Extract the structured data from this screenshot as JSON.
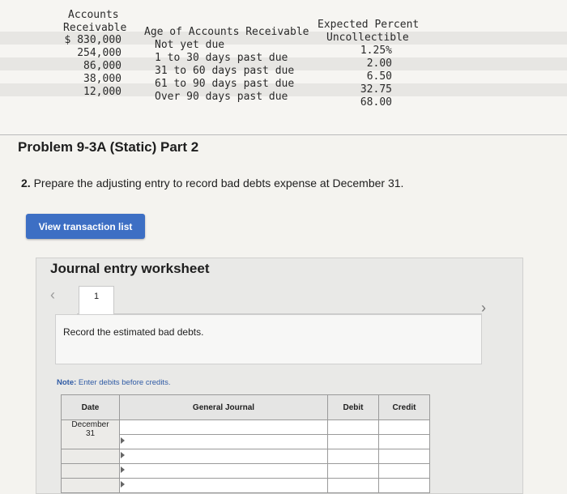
{
  "aging_schedule": {
    "receivable_header": [
      "Accounts",
      "Receivable"
    ],
    "age_header": "Age of Accounts Receivable",
    "percent_header": [
      "Expected Percent",
      "Uncollectible"
    ],
    "rows": [
      {
        "amount": "$ 830,000",
        "age": "Not yet due",
        "percent": "1.25%"
      },
      {
        "amount": "254,000",
        "age": "1 to 30 days past due",
        "percent": "2.00"
      },
      {
        "amount": "86,000",
        "age": "31 to 60 days past due",
        "percent": "6.50"
      },
      {
        "amount": "38,000",
        "age": "61 to 90 days past due",
        "percent": "32.75"
      },
      {
        "amount": "12,000",
        "age": "Over 90 days past due",
        "percent": "68.00"
      }
    ]
  },
  "problem": {
    "title": "Problem 9-3A (Static) Part 2",
    "instruction_number": "2.",
    "instruction_text": " Prepare the adjusting entry to record bad debts expense at December 31."
  },
  "view_transaction_button": "View transaction list",
  "worksheet": {
    "title": "Journal entry worksheet",
    "tab_number": "1",
    "description": "Record the estimated bad debts.",
    "note_label": "Note:",
    "note_text": " Enter debits before credits."
  },
  "journal_table": {
    "headers": {
      "date": "Date",
      "general_journal": "General Journal",
      "debit": "Debit",
      "credit": "Credit"
    },
    "date_month": "December",
    "date_day": "31"
  },
  "colors": {
    "button_blue": "#3d6fc4",
    "note_blue": "#2e5aa4"
  },
  "icons": {
    "prev": "chevron-left-icon",
    "next": "chevron-right-icon",
    "row_arrow": "triangle-right-icon"
  }
}
